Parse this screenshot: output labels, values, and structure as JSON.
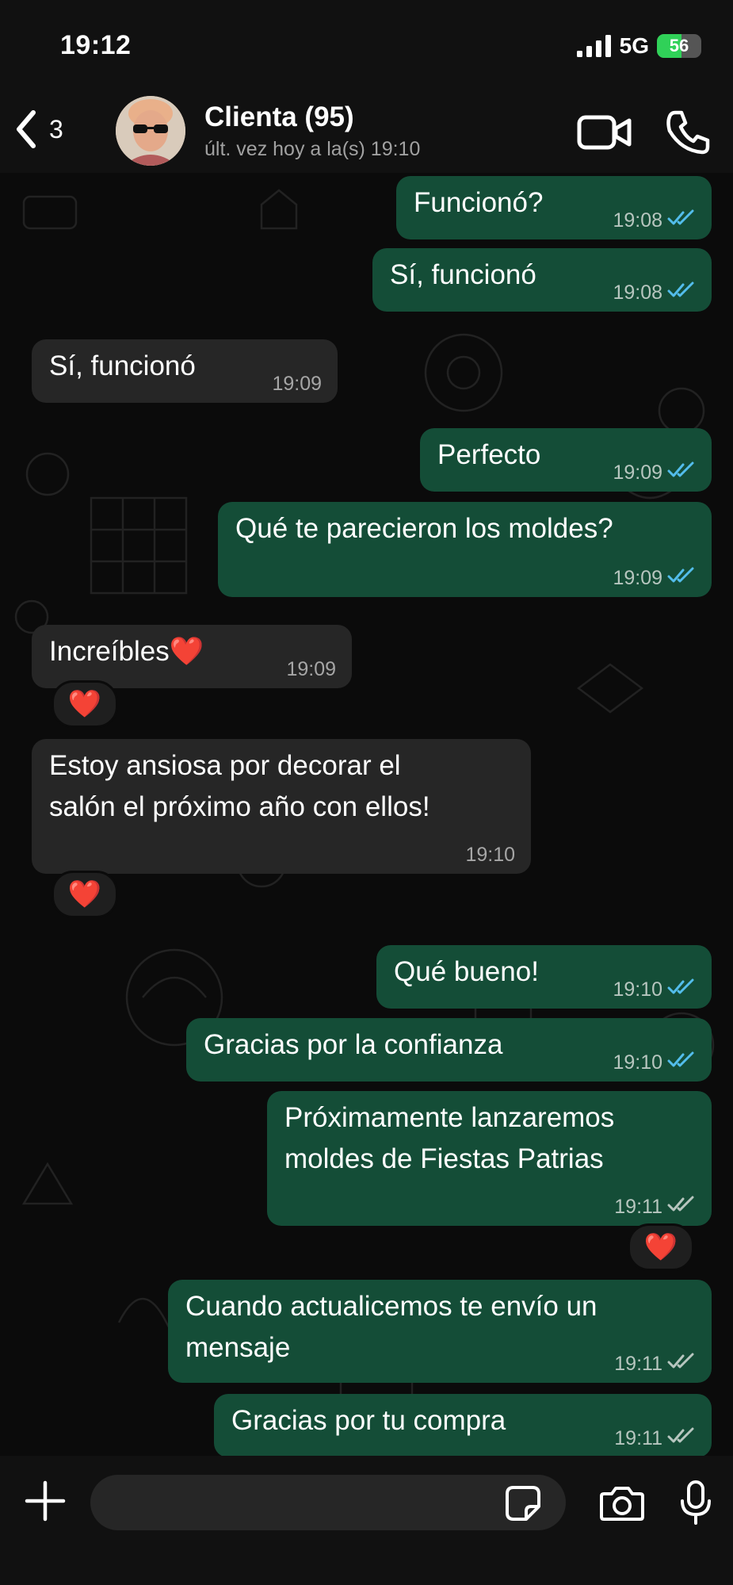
{
  "status": {
    "time": "19:12",
    "network": "5G",
    "battery": "56",
    "battery_level": 0.56
  },
  "header": {
    "back_count": "3",
    "contact_name": "Clienta (95)",
    "last_seen": "últ. vez hoy a la(s) 19:10"
  },
  "messages": [
    {
      "dir": "out",
      "text": "Funcionó?",
      "time": "19:08",
      "status": "read"
    },
    {
      "dir": "out",
      "text": "Sí, funcionó",
      "time": "19:08",
      "status": "read"
    },
    {
      "dir": "in",
      "text": "Sí, funcionó",
      "time": "19:09"
    },
    {
      "dir": "out",
      "text": "Perfecto",
      "time": "19:09",
      "status": "read"
    },
    {
      "dir": "out",
      "text": "Qué te parecieron los moldes?",
      "time": "19:09",
      "status": "read"
    },
    {
      "dir": "in",
      "text": "Increíbles❤️",
      "time": "19:09",
      "reaction": "❤️"
    },
    {
      "dir": "in",
      "text": "Estoy ansiosa por decorar el\nsalón el próximo año con ellos!",
      "time": "19:10",
      "reaction": "❤️"
    },
    {
      "dir": "out",
      "text": "Qué bueno!",
      "time": "19:10",
      "status": "read"
    },
    {
      "dir": "out",
      "text": "Gracias por la confianza",
      "time": "19:10",
      "status": "read"
    },
    {
      "dir": "out",
      "text": "Próximamente lanzaremos\nmoldes de Fiestas Patrias",
      "time": "19:11",
      "status": "delivered",
      "reaction": "❤️"
    },
    {
      "dir": "out",
      "text": "Cuando actualicemos te envío un\nmensaje",
      "time": "19:11",
      "status": "delivered"
    },
    {
      "dir": "out",
      "text": "Gracias por tu compra",
      "time": "19:11",
      "status": "delivered"
    }
  ],
  "input": {
    "placeholder": ""
  },
  "icons": {
    "back": "chevron-left-icon",
    "video": "video-call-icon",
    "call": "phone-icon",
    "plus": "plus-icon",
    "sticker": "sticker-icon",
    "camera": "camera-icon",
    "mic": "microphone-icon"
  },
  "colors": {
    "outgoing_bubble": "#144d37",
    "incoming_bubble": "#262626",
    "read_tick": "#53bdeb",
    "delivered_tick": "#b7c6bf",
    "reaction_heart": "#f02f4f"
  }
}
